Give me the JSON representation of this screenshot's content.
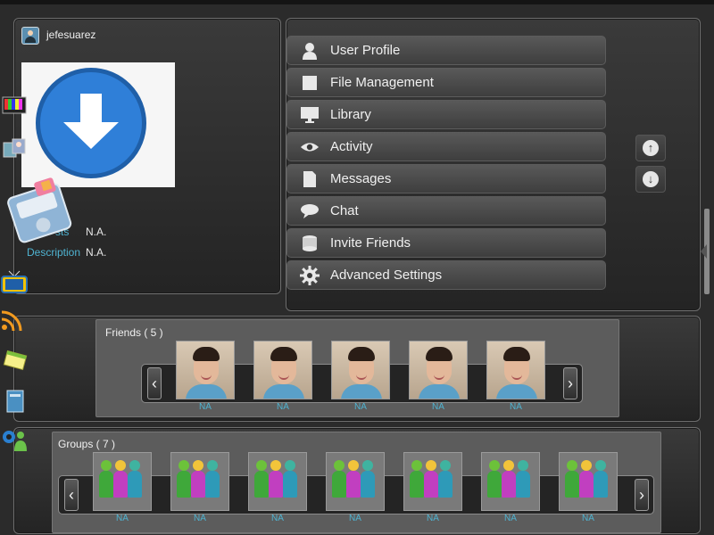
{
  "profile": {
    "username": "jefesuarez",
    "fields": [
      {
        "label": "sts",
        "value": "N.A."
      },
      {
        "label": "Description",
        "value": "N.A."
      }
    ]
  },
  "menu": {
    "items": [
      {
        "label": "User Profile",
        "icon": "user-icon"
      },
      {
        "label": "File Management",
        "icon": "file-management-icon"
      },
      {
        "label": "Library",
        "icon": "monitor-icon"
      },
      {
        "label": "Activity",
        "icon": "eye-icon"
      },
      {
        "label": "Messages",
        "icon": "document-icon"
      },
      {
        "label": "Chat",
        "icon": "speech-bubble-icon"
      },
      {
        "label": "Invite Friends",
        "icon": "database-icon"
      },
      {
        "label": "Advanced Settings",
        "icon": "gear-icon"
      }
    ]
  },
  "friends": {
    "title": "Friends ( 5 )",
    "items": [
      {
        "label": "NA"
      },
      {
        "label": "NA"
      },
      {
        "label": "NA"
      },
      {
        "label": "NA"
      },
      {
        "label": "NA"
      }
    ]
  },
  "groups": {
    "title": "Groups ( 7 )",
    "items": [
      {
        "label": "NA"
      },
      {
        "label": "NA"
      },
      {
        "label": "NA"
      },
      {
        "label": "NA"
      },
      {
        "label": "NA"
      },
      {
        "label": "NA"
      },
      {
        "label": "NA"
      }
    ]
  },
  "colors": {
    "accent": "#4fb3d1",
    "panel": "#2b2b2b"
  }
}
